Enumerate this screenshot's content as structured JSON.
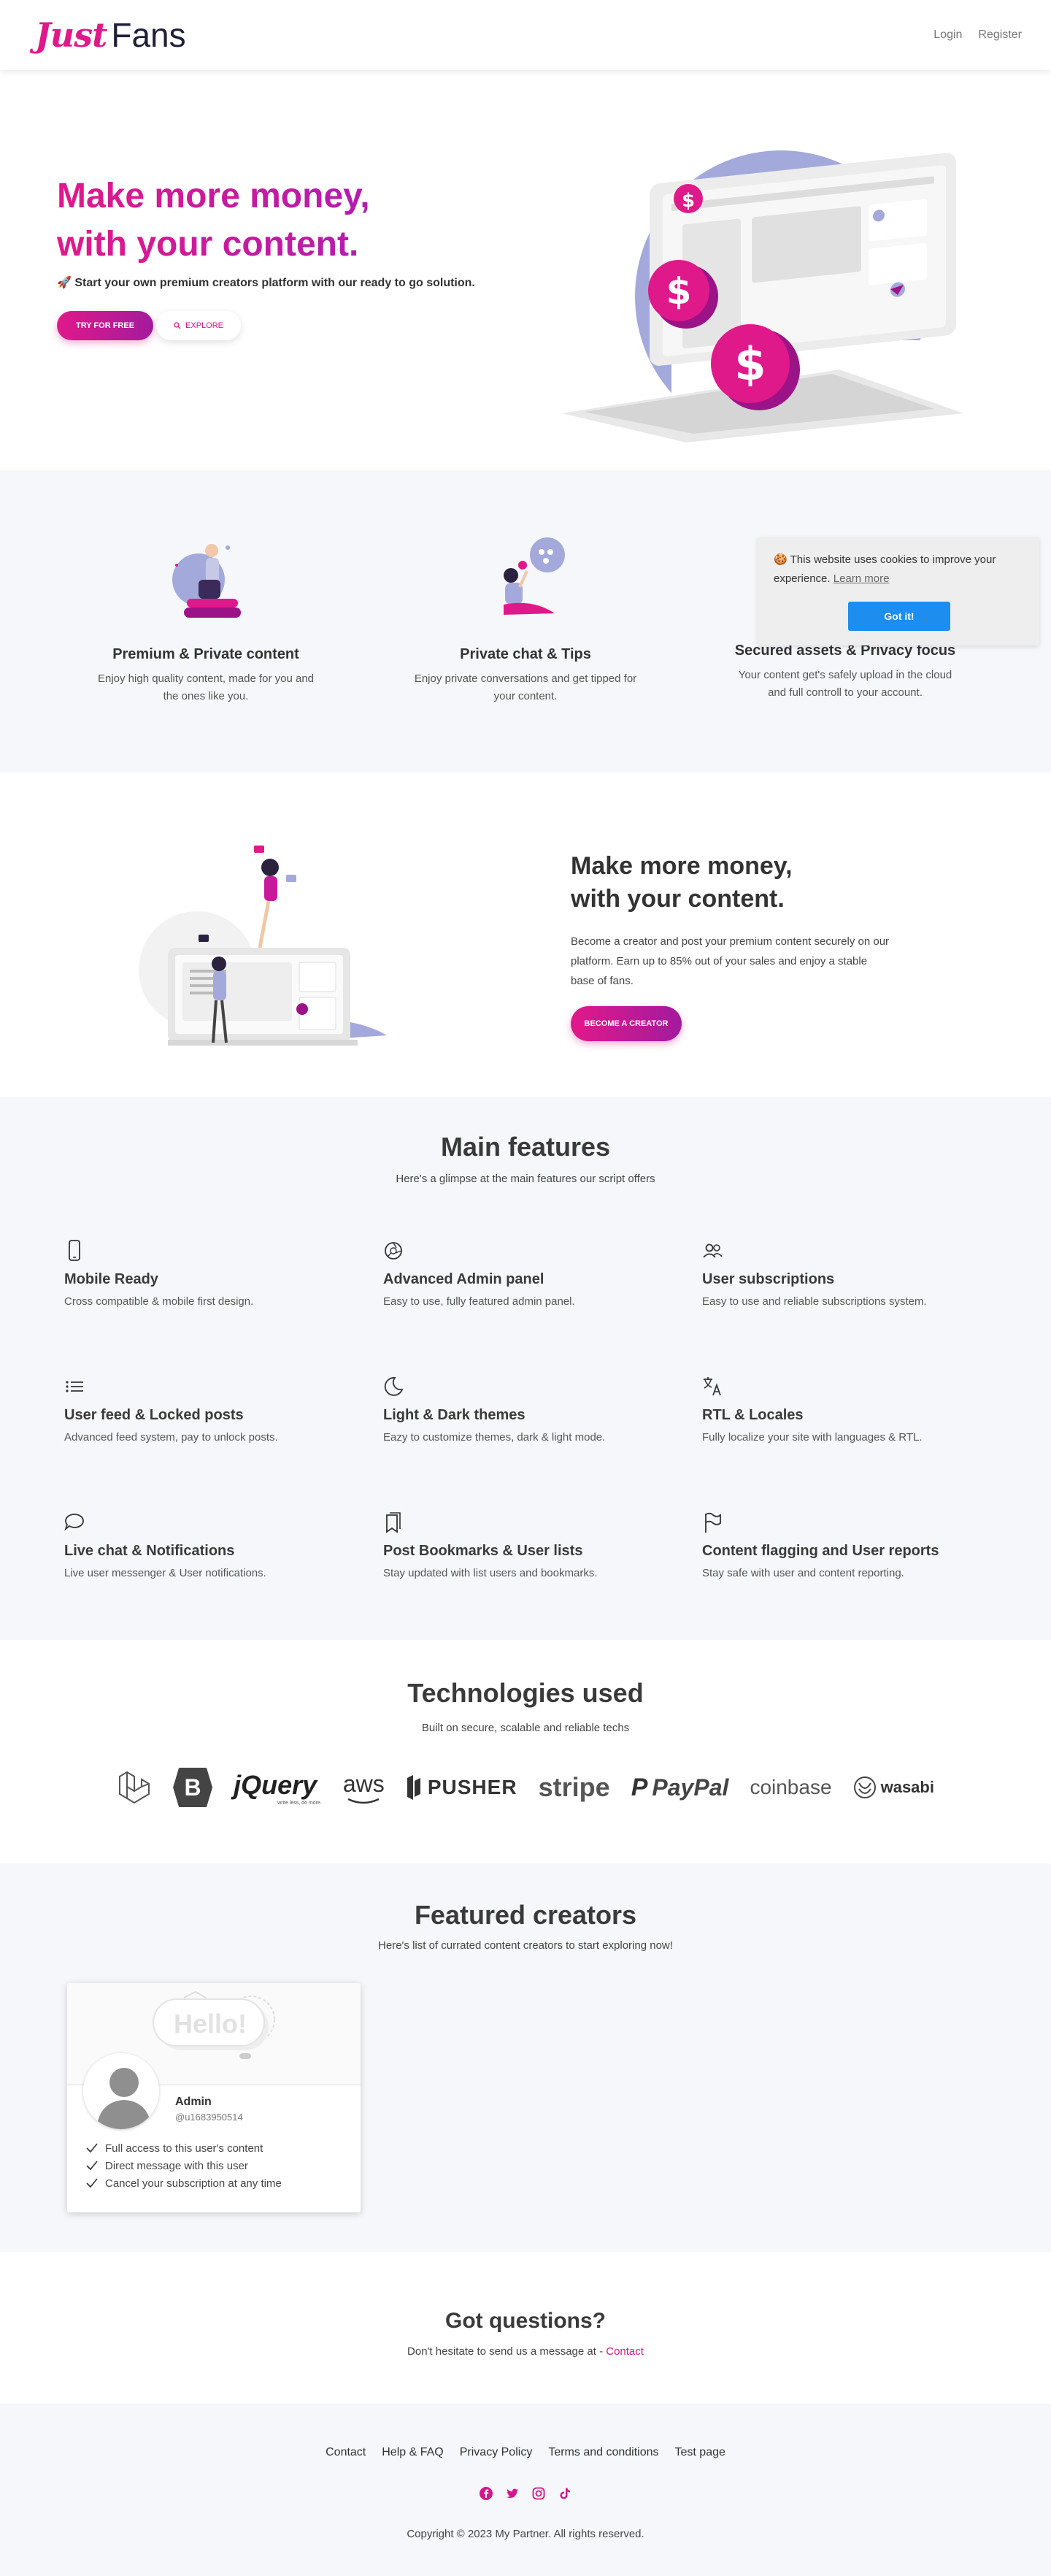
{
  "brand": {
    "logo_script": "Just",
    "logo_rest": "Fans"
  },
  "nav": {
    "login": "Login",
    "register": "Register"
  },
  "hero": {
    "title_line1": "Make more money,",
    "title_line2": "with your content.",
    "subtitle": "🚀 Start your own premium creators platform with our ready to go solution.",
    "try_label": "TRY FOR FREE",
    "explore_label": "EXPLORE"
  },
  "features_row": [
    {
      "title": "Premium & Private content",
      "text": "Enjoy high quality content, made for you and the ones like you."
    },
    {
      "title": "Private chat & Tips",
      "text": "Enjoy private conversations and get tipped for your content."
    },
    {
      "title": "Secured assets & Privacy focus",
      "text": "Your content get's safely upload in the cloud and full controll to your account."
    }
  ],
  "cookie": {
    "message": "🍪 This website uses cookies to improve your experience.",
    "learn_more": "Learn more",
    "button": "Got it!"
  },
  "creator": {
    "title_line1": "Make more money,",
    "title_line2": "with your content.",
    "text": "Become a creator and post your premium content securely on our platform. Earn up to 85% out of your sales and enjoy a stable base of fans.",
    "button": "BECOME A CREATOR"
  },
  "main_features": {
    "title": "Main features",
    "subtitle": "Here's a glimpse at the main features our script offers",
    "items": [
      {
        "title": "Mobile Ready",
        "text": "Cross compatible & mobile first design.",
        "icon": "phone-icon"
      },
      {
        "title": "Advanced Admin panel",
        "text": "Easy to use, fully featured admin panel.",
        "icon": "aperture-icon"
      },
      {
        "title": "User subscriptions",
        "text": "Easy to use and reliable subscriptions system.",
        "icon": "people-icon"
      },
      {
        "title": "User feed & Locked posts",
        "text": "Advanced feed system, pay to unlock posts.",
        "icon": "list-icon"
      },
      {
        "title": "Light & Dark themes",
        "text": "Eazy to customize themes, dark & light mode.",
        "icon": "moon-icon"
      },
      {
        "title": "RTL & Locales",
        "text": "Fully localize your site with languages & RTL.",
        "icon": "language-icon"
      },
      {
        "title": "Live chat & Notifications",
        "text": "Live user messenger & User notifications.",
        "icon": "chat-icon"
      },
      {
        "title": "Post Bookmarks & User lists",
        "text": "Stay updated with list users and bookmarks.",
        "icon": "bookmarks-icon"
      },
      {
        "title": "Content flagging and User reports",
        "text": "Stay safe with user and content reporting.",
        "icon": "flag-icon"
      }
    ]
  },
  "tech": {
    "title": "Technologies used",
    "subtitle": "Built on secure, scalable and reliable techs",
    "logos": {
      "jquery": "jQuery",
      "jquery_tag": "write less, do more.",
      "aws": "aws",
      "pusher": "PUSHER",
      "stripe": "stripe",
      "paypal": "PayPal",
      "coinbase": "coinbase",
      "wasabi": "wasabi"
    }
  },
  "featured": {
    "title": "Featured creators",
    "subtitle": "Here's list of currated content creators to start exploring now!",
    "creator": {
      "cover_text": "Hello!",
      "name": "Admin",
      "handle": "@u1683950514",
      "perks": [
        "Full access to this user's content",
        "Direct message with this user",
        "Cancel your subscription at any time"
      ]
    }
  },
  "questions": {
    "title": "Got questions?",
    "text": "Don't hesitate to send us a message at - ",
    "contact": "Contact"
  },
  "footer": {
    "links": [
      "Contact",
      "Help & FAQ",
      "Privacy Policy",
      "Terms and conditions",
      "Test page"
    ],
    "copyright": "Copyright © 2023 My Partner. All rights reserved."
  },
  "colors": {
    "brand": "#e0198a",
    "brand_dark": "#a31a9d",
    "accent_blue": "#1d8df0",
    "illustration_blue": "#a3a9da"
  }
}
